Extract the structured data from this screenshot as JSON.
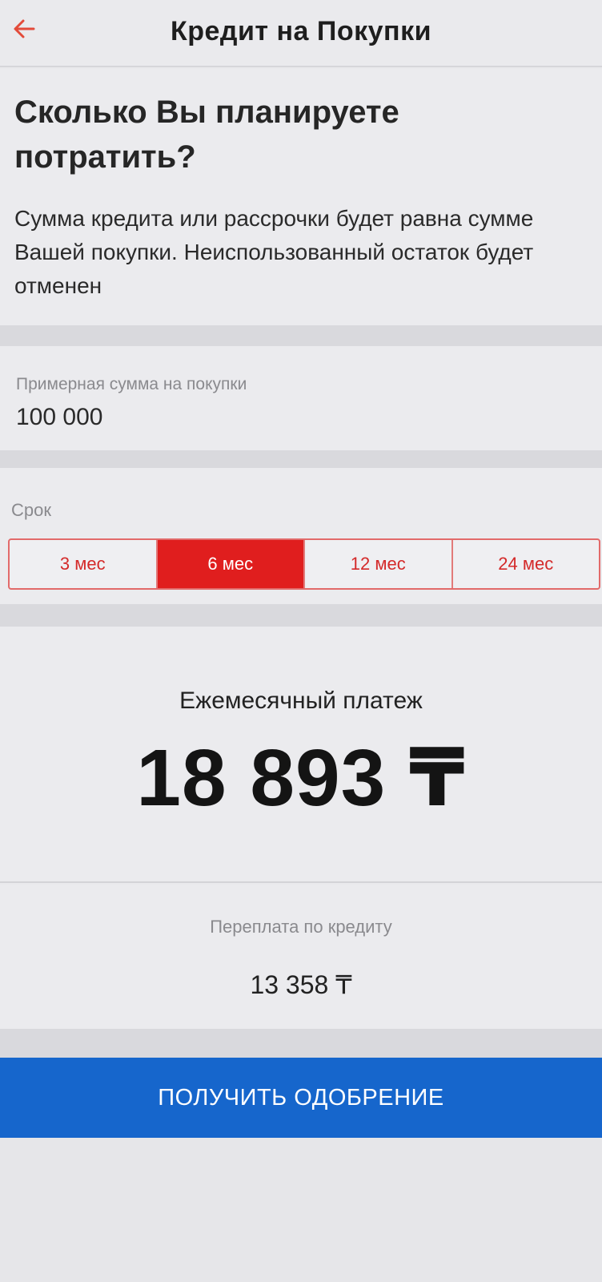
{
  "header": {
    "title": "Кредит на Покупки",
    "back_icon": "arrow-left-icon",
    "accent_color": "#e34b3a"
  },
  "intro": {
    "heading": "Сколько Вы планируете потратить?",
    "text": "Сумма кредита или рассрочки будет равна сумме Вашей покупки. Неиспользованный остаток будет отменен"
  },
  "amount": {
    "label": "Примерная сумма на покупки",
    "value": "100 000"
  },
  "term": {
    "label": "Срок",
    "options": [
      "3 мес",
      "6 мес",
      "12 мес",
      "24 мес"
    ],
    "selected": "6 мес",
    "active_color": "#e01e1e"
  },
  "payment": {
    "label": "Ежемесячный платеж",
    "value": "18 893 ₸"
  },
  "overpayment": {
    "label": "Переплата по кредиту",
    "value": "13 358 ₸"
  },
  "cta": {
    "label": "ПОЛУЧИТЬ ОДОБРЕНИЕ",
    "color": "#1666cc"
  }
}
